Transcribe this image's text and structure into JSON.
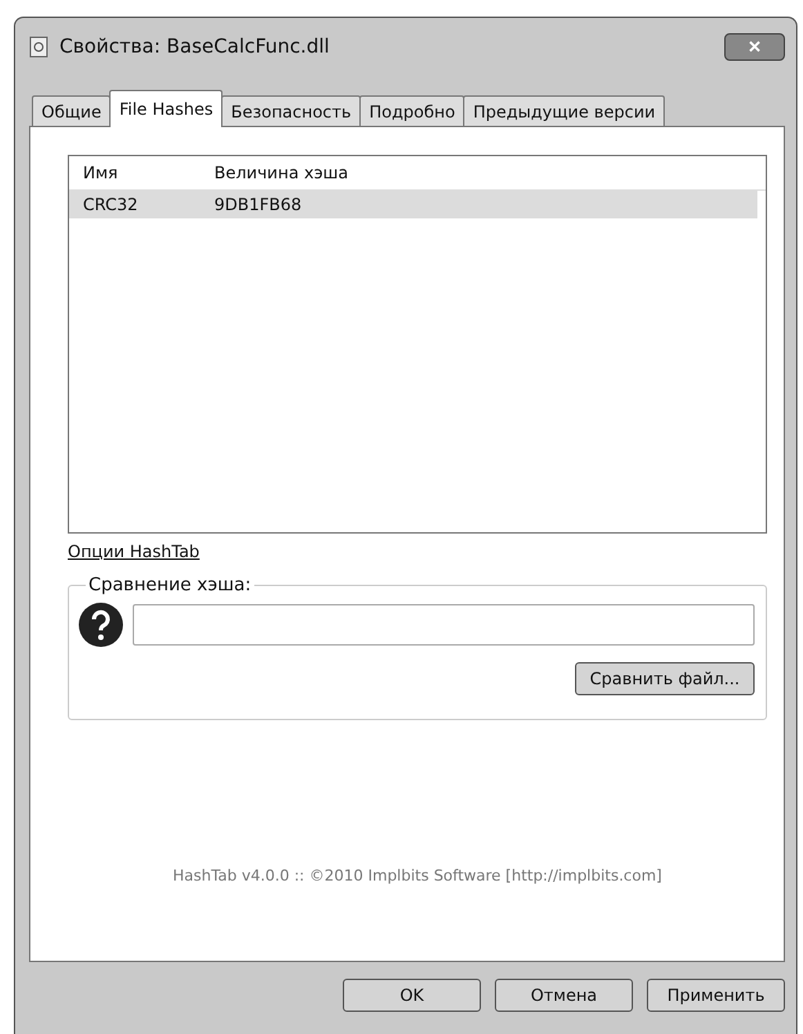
{
  "window": {
    "title": "Свойства: BaseCalcFunc.dll",
    "close": "✕"
  },
  "tabs": [
    {
      "label": "Общие",
      "selected": false
    },
    {
      "label": "File Hashes",
      "selected": true
    },
    {
      "label": "Безопасность",
      "selected": false
    },
    {
      "label": "Подробно",
      "selected": false
    },
    {
      "label": "Предыдущие версии",
      "selected": false
    }
  ],
  "table": {
    "columns": [
      "Имя",
      "Величина хэша"
    ],
    "rows": [
      {
        "cells": [
          "CRC32",
          "9DB1FB68"
        ],
        "selected": true
      }
    ]
  },
  "options_link": "Опции HashTab",
  "compare": {
    "title": "Сравнение хэша:",
    "button": "Сравнить файл..."
  },
  "footer": "HashTab v4.0.0 :: ©2010 Implbits Software [http://implbits.com]",
  "buttons": [
    "OK",
    "Отмена",
    "Применить"
  ]
}
